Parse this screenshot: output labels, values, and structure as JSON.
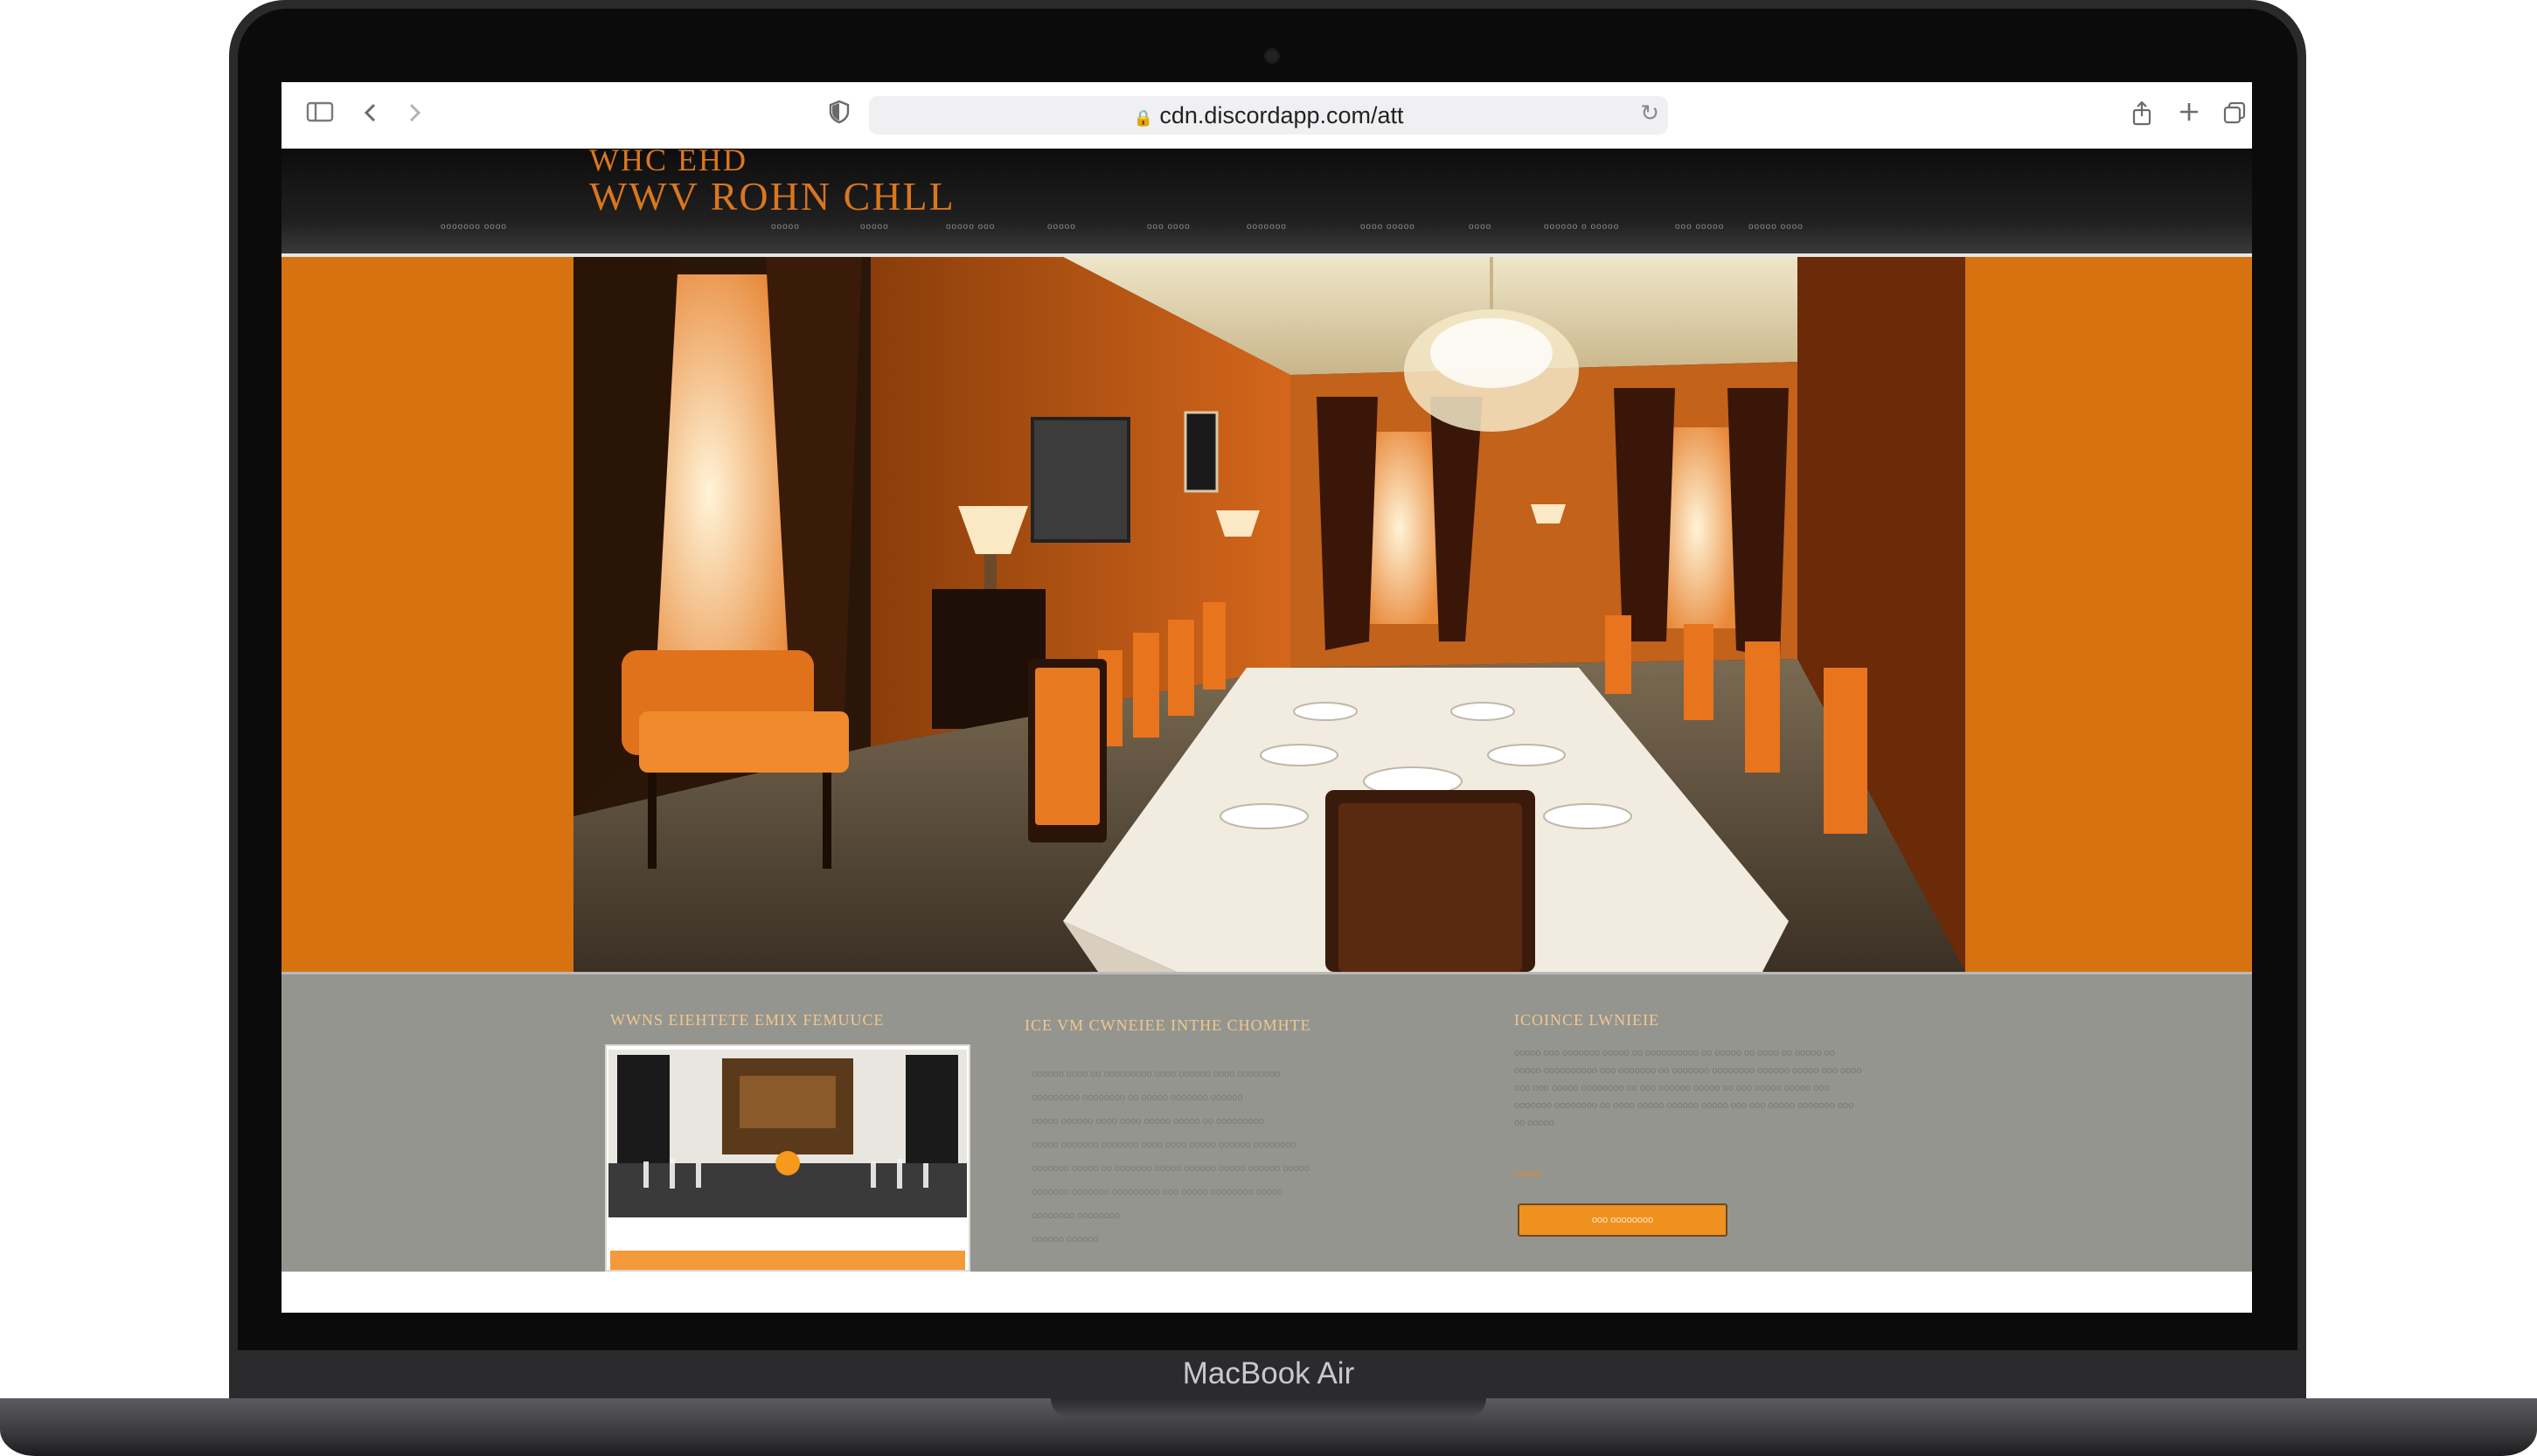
{
  "device": {
    "model_label": "MacBook Air"
  },
  "browser": {
    "url": "cdn.discordapp.com/att",
    "icons": [
      "sidebar-icon",
      "back-icon",
      "forward-icon",
      "shield-icon",
      "lock-icon",
      "reload-icon",
      "share-icon",
      "new-tab-icon",
      "tabs-icon"
    ]
  },
  "site": {
    "logo_top": "WHC EHD",
    "logo_main": "WWV ROHN CHLL",
    "nav_items": [
      "ooooooo oooo",
      "ooooo",
      "ooooo",
      "ooooo ooo",
      "ooooo",
      "ooo oooo",
      "ooooooo",
      "oooo ooooo",
      "oooo",
      "oooooo o ooooo",
      "ooo ooooo",
      "ooooo oooo"
    ]
  },
  "hero": {
    "accent": "#d67310"
  },
  "sections": {
    "col1_title": "WWNS EIEHTETE EMIX FEMUUCE",
    "col2_title": "ICE VM CWNEIEE INTHE CHOMHTE",
    "col3_title": "ICOINCE LWNIEIE",
    "bullets": [
      "oooooo oooo oo ooooooooo oooo oooooo oooo oooooooo",
      "ooooooooo oooooooo oo ooooo ooooooo oooooo",
      "ooooo oooooo oooo oooo ooooo ooooo oo ooooooooo",
      "ooooo ooooooo ooooooo oooo oooo ooooo oooooo oooooooo",
      "ooooooo ooooo oo ooooooo ooooo oooooo ooooo oooooo ooooo",
      "ooooooo ooooooo ooooooooo ooo ooooo oooooooo ooooo",
      "oooooooo oooooooo",
      "oooooo oooooo"
    ],
    "para_lines": [
      "ooooo ooo ooooooo ooooo oo oooooooooo oo ooooo oo oooo oo ooooo oo",
      "ooooo oooooooooo ooo ooooooo oo ooooooo oooooooo oooooo ooooo ooo oooo",
      "ooo ooo ooooo oooooooo oo ooo oooooo ooooo oo ooo ooooo ooooo ooo",
      "ooooooo oooooooo oo oooo ooooo oooooo ooooo ooo ooo ooooo ooooooo ooo",
      "oo ooooo"
    ],
    "more_label": "ooooo",
    "cta_label": "ooo oooooooo"
  }
}
